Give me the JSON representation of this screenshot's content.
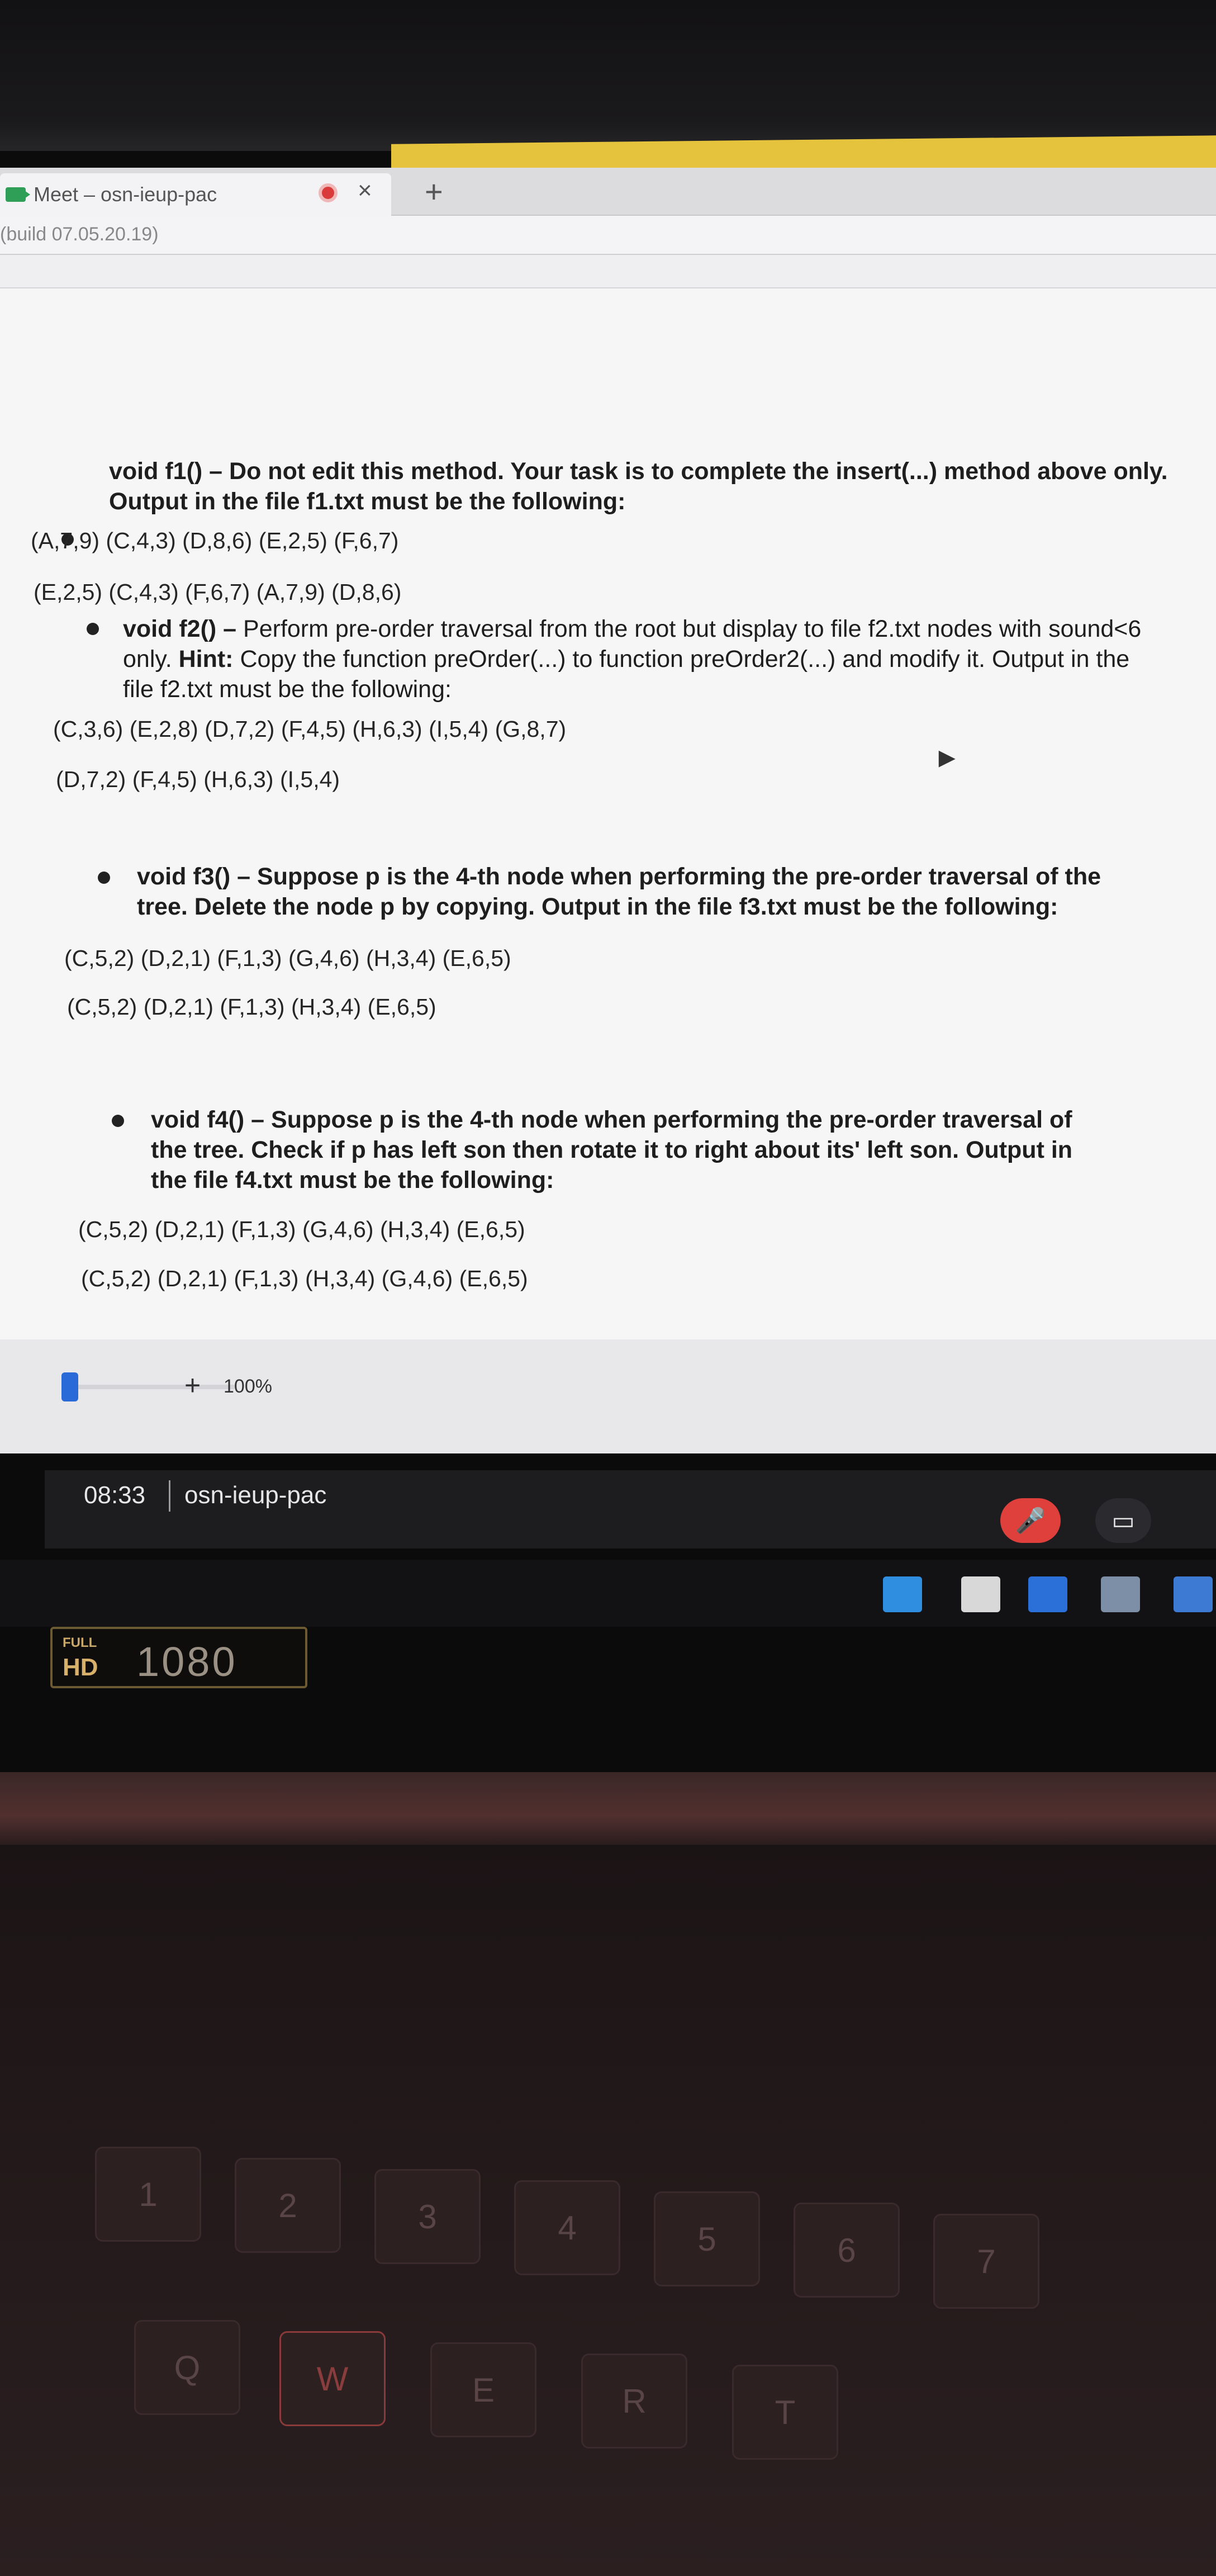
{
  "browser": {
    "tab_title": "Meet – osn-ieup-pac",
    "tab_close": "×",
    "new_tab": "+",
    "build": "(build 07.05.20.19)"
  },
  "document": {
    "f1": {
      "prefix": "void f1() – ",
      "text": "Do not edit this method. Your task is to complete the insert(...) method above only. Output in the file f1.txt must be the following:",
      "output_1": "(A,7,9) (C,4,3) (D,8,6) (E,2,5) (F,6,7)",
      "output_2": "(E,2,5) (C,4,3) (F,6,7) (A,7,9) (D,8,6)"
    },
    "f2": {
      "prefix": "void f2() – ",
      "text_a": "Perform pre-order traversal from the root but display to file f2.txt nodes with sound<6 only. ",
      "hint_label": "Hint:",
      "text_b": " Copy the function preOrder(...) to function preOrder2(...) and modify it. Output in the file f2.txt must be the following:",
      "output_1": "(C,3,6) (E,2,8) (D,7,2) (F,4,5) (H,6,3) (I,5,4) (G,8,7)",
      "output_2": "(D,7,2) (F,4,5) (H,6,3) (I,5,4)"
    },
    "f3": {
      "prefix": "void f3() – ",
      "text": "Suppose p is the 4-th node when performing the pre-order traversal of the tree. Delete the node p by copying. Output in the file f3.txt must be the following:",
      "output_1": "(C,5,2) (D,2,1) (F,1,3) (G,4,6) (H,3,4) (E,6,5)",
      "output_2": "(C,5,2) (D,2,1) (F,1,3) (H,3,4) (E,6,5)"
    },
    "f4": {
      "prefix": "void f4() – ",
      "text": "Suppose p is the 4-th node when performing the pre-order traversal of the tree. Check if p has left son then rotate it to right about its' left son. Output in the file f4.txt must be the following:",
      "output_1": "(C,5,2) (D,2,1) (F,1,3) (G,4,6) (H,3,4) (E,6,5)",
      "output_2": "(C,5,2) (D,2,1) (F,1,3) (H,3,4) (G,4,6) (E,6,5)"
    }
  },
  "zoom": {
    "plus": "+",
    "value": "100%"
  },
  "meet": {
    "time": "08:33",
    "meeting_code": "osn-ieup-pac",
    "mic_icon": "mic-off-icon",
    "camera_icon": "camera-icon",
    "mic_color": "#e0403b"
  },
  "overlay": {
    "full_label": "FULL",
    "hd_label": "HD",
    "resolution": "1080"
  },
  "keyboard": {
    "keys_row1": [
      "1",
      "2",
      "3",
      "4",
      "5",
      "6",
      "7"
    ],
    "keys_row2": [
      "Q",
      "W",
      "E",
      "R",
      "T"
    ]
  }
}
